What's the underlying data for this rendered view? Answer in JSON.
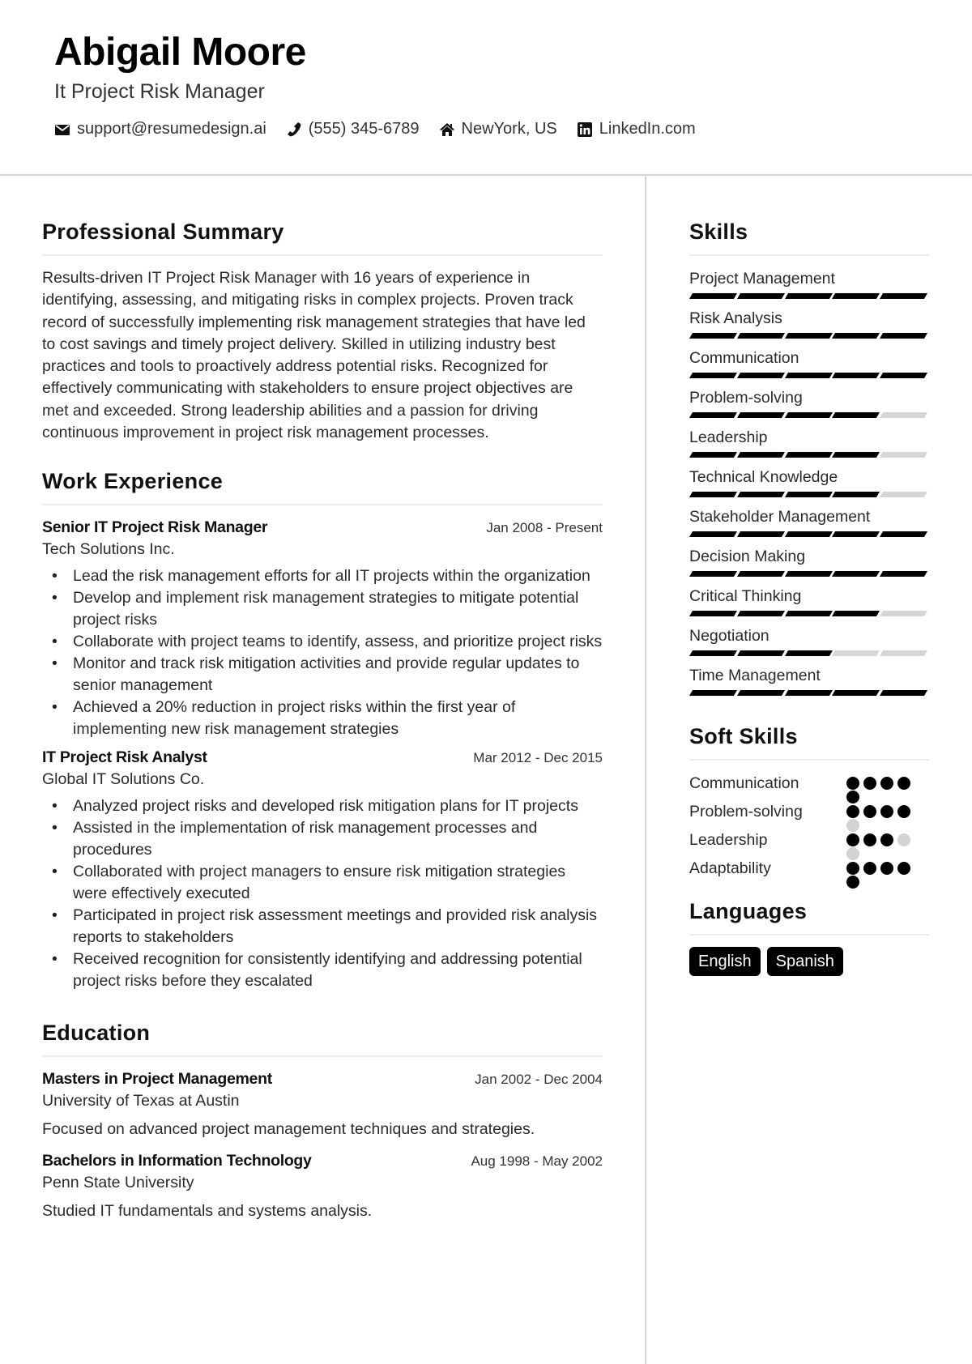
{
  "header": {
    "name": "Abigail Moore",
    "role": "It Project Risk Manager",
    "contacts": [
      {
        "icon": "envelope-icon",
        "text": "support@resumedesign.ai"
      },
      {
        "icon": "phone-icon",
        "text": "(555) 345-6789"
      },
      {
        "icon": "home-icon",
        "text": "NewYork, US"
      },
      {
        "icon": "linkedin-icon",
        "text": "LinkedIn.com"
      }
    ]
  },
  "summary": {
    "title": "Professional Summary",
    "text": "Results-driven IT Project Risk Manager with 16 years of experience in identifying, assessing, and mitigating risks in complex projects. Proven track record of successfully implementing risk management strategies that have led to cost savings and timely project delivery. Skilled in utilizing industry best practices and tools to proactively address potential risks. Recognized for effectively communicating with stakeholders to ensure project objectives are met and exceeded. Strong leadership abilities and a passion for driving continuous improvement in project risk management processes."
  },
  "experience": {
    "title": "Work Experience",
    "jobs": [
      {
        "title": "Senior IT Project Risk Manager",
        "date": "Jan 2008 - Present",
        "company": "Tech Solutions Inc.",
        "bullets": [
          "Lead the risk management efforts for all IT projects within the organization",
          "Develop and implement risk management strategies to mitigate potential project risks",
          "Collaborate with project teams to identify, assess, and prioritize project risks",
          "Monitor and track risk mitigation activities and provide regular updates to senior management",
          "Achieved a 20% reduction in project risks within the first year of implementing new risk management strategies"
        ]
      },
      {
        "title": "IT Project Risk Analyst",
        "date": "Mar 2012 - Dec 2015",
        "company": "Global IT Solutions Co.",
        "bullets": [
          "Analyzed project risks and developed risk mitigation plans for IT projects",
          "Assisted in the implementation of risk management processes and procedures",
          "Collaborated with project managers to ensure risk mitigation strategies were effectively executed",
          "Participated in project risk assessment meetings and provided risk analysis reports to stakeholders",
          "Received recognition for consistently identifying and addressing potential project risks before they escalated"
        ]
      }
    ]
  },
  "education": {
    "title": "Education",
    "items": [
      {
        "degree": "Masters in Project Management",
        "date": "Jan 2002 - Dec 2004",
        "school": "University of Texas at Austin",
        "desc": "Focused on advanced project management techniques and strategies."
      },
      {
        "degree": "Bachelors in Information Technology",
        "date": "Aug 1998 - May 2002",
        "school": "Penn State University",
        "desc": "Studied IT fundamentals and systems analysis."
      }
    ]
  },
  "skills": {
    "title": "Skills",
    "max": 5,
    "items": [
      {
        "name": "Project Management",
        "level": 5
      },
      {
        "name": "Risk Analysis",
        "level": 5
      },
      {
        "name": "Communication",
        "level": 5
      },
      {
        "name": "Problem-solving",
        "level": 4
      },
      {
        "name": "Leadership",
        "level": 4
      },
      {
        "name": "Technical Knowledge",
        "level": 4
      },
      {
        "name": "Stakeholder Management",
        "level": 5
      },
      {
        "name": "Decision Making",
        "level": 5
      },
      {
        "name": "Critical Thinking",
        "level": 4
      },
      {
        "name": "Negotiation",
        "level": 3
      },
      {
        "name": "Time Management",
        "level": 5
      }
    ]
  },
  "soft_skills": {
    "title": "Soft Skills",
    "max": 5,
    "items": [
      {
        "name": "Communication",
        "level": 5
      },
      {
        "name": "Problem-solving",
        "level": 4
      },
      {
        "name": "Leadership",
        "level": 3
      },
      {
        "name": "Adaptability",
        "level": 5
      }
    ]
  },
  "languages": {
    "title": "Languages",
    "items": [
      "English",
      "Spanish"
    ]
  }
}
